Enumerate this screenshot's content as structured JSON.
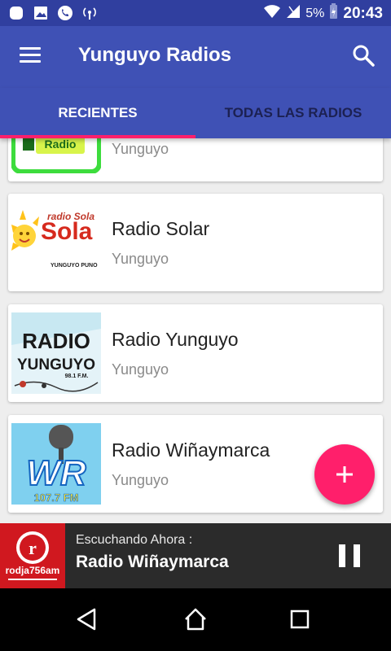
{
  "status_bar": {
    "battery": "5%",
    "time": "20:43"
  },
  "app_bar": {
    "title": "Yunguyo Radios",
    "menu_icon": "hamburger-menu-icon",
    "search_icon": "search-icon"
  },
  "tabs": [
    {
      "label": "RECIENTES",
      "selected": true
    },
    {
      "label": "TODAS LAS RADIOS",
      "selected": false
    }
  ],
  "radios": [
    {
      "name": "",
      "location": "Yunguyo",
      "logo": "radio-logo-green"
    },
    {
      "name": "Radio Solar",
      "location": "Yunguyo",
      "logo": "radio-solar-logo",
      "logo_text": "radio Sola",
      "logo_sub": "YUNGUYO PUNO"
    },
    {
      "name": "Radio Yunguyo",
      "location": "Yunguyo",
      "logo": "radio-yunguyo-logo",
      "logo_text": "RADIO",
      "logo_text2": "YUNGUYO",
      "logo_sub": "98.1 F.M."
    },
    {
      "name": "Radio Wiñaymarca",
      "location": "Yunguyo",
      "logo": "radio-winaymarca-logo",
      "logo_text": "WR",
      "logo_sub": "107.7 FM"
    }
  ],
  "fab": {
    "icon": "plus-icon"
  },
  "now_playing": {
    "label": "Escuchando Ahora :",
    "title": "Radio Wiñaymarca",
    "logo_text": "rodja756am",
    "pause_icon": "pause-icon"
  },
  "nav": [
    "back-icon",
    "home-icon",
    "recents-icon"
  ],
  "colors": {
    "primary": "#3f51b5",
    "primary_dark": "#303f9f",
    "accent": "#ff1f6b"
  }
}
